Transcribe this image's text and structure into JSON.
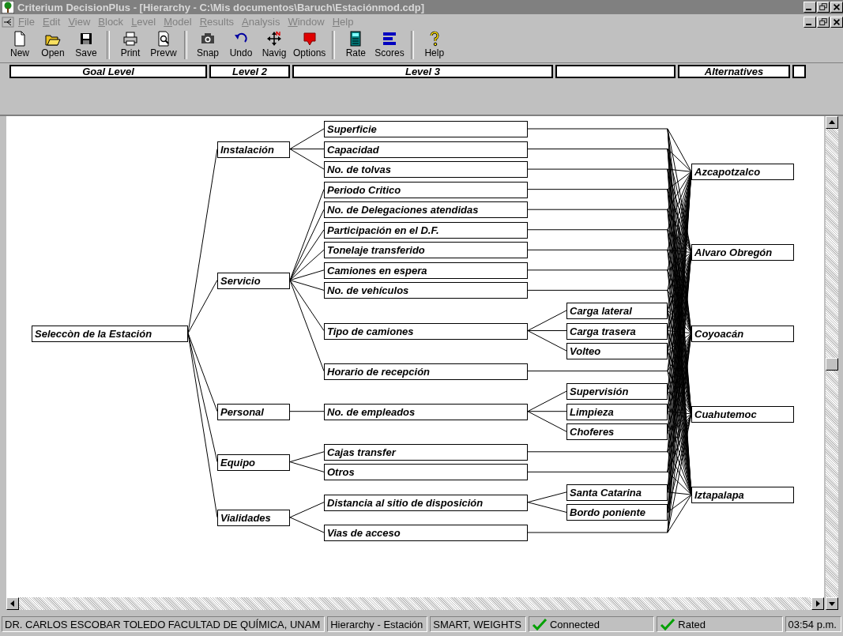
{
  "window": {
    "title": "Criterium DecisionPlus - [Hierarchy - C:\\Mis documentos\\Baruch\\Estaciónmod.cdp]"
  },
  "menu": [
    {
      "label": "File",
      "disabled": true
    },
    {
      "label": "Edit",
      "disabled": true
    },
    {
      "label": "View",
      "disabled": true
    },
    {
      "label": "Block",
      "disabled": true
    },
    {
      "label": "Level",
      "disabled": true
    },
    {
      "label": "Model",
      "disabled": true
    },
    {
      "label": "Results",
      "disabled": true
    },
    {
      "label": "Analysis",
      "disabled": true
    },
    {
      "label": "Window",
      "disabled": true
    },
    {
      "label": "Help",
      "disabled": true
    }
  ],
  "toolbar": {
    "groups": [
      [
        "New",
        "Open",
        "Save"
      ],
      [
        "Print",
        "Prevw"
      ],
      [
        "Snap",
        "Undo",
        "Navig",
        "Options"
      ],
      [
        "Rate",
        "Scores"
      ],
      [
        "Help"
      ]
    ]
  },
  "levels": [
    "Goal Level",
    "Level 2",
    "Level 3",
    "Alternatives"
  ],
  "hierarchy": {
    "label": "Seleccòn de la Estación",
    "children": [
      {
        "label": "Instalación",
        "children": [
          {
            "label": "Superficie"
          },
          {
            "label": "Capacidad"
          },
          {
            "label": "No. de tolvas"
          }
        ]
      },
      {
        "label": "Servicio",
        "children": [
          {
            "label": "Periodo Critico"
          },
          {
            "label": "No. de Delegaciones atendidas"
          },
          {
            "label": "Participación en el D.F."
          },
          {
            "label": "Tonelaje transferido"
          },
          {
            "label": "Camiones en espera"
          },
          {
            "label": "No. de vehículos"
          },
          {
            "label": "Tipo de camiones",
            "children": [
              {
                "label": "Carga lateral"
              },
              {
                "label": "Carga trasera"
              },
              {
                "label": "Volteo"
              }
            ]
          },
          {
            "label": "Horario de recepción"
          }
        ]
      },
      {
        "label": "Personal",
        "children": [
          {
            "label": "No. de empleados",
            "children": [
              {
                "label": "Supervisión"
              },
              {
                "label": "Limpieza"
              },
              {
                "label": "Choferes"
              }
            ]
          }
        ]
      },
      {
        "label": "Equipo",
        "children": [
          {
            "label": "Cajas transfer"
          },
          {
            "label": "Otros"
          }
        ]
      },
      {
        "label": "Vialidades",
        "children": [
          {
            "label": "Distancia al sitio de disposición",
            "children": [
              {
                "label": "Santa Catarina"
              },
              {
                "label": "Bordo poniente"
              }
            ]
          },
          {
            "label": "Vias de acceso"
          }
        ]
      }
    ]
  },
  "alternatives": [
    "Azcapotzalco",
    "Alvaro Obregón",
    "Coyoacán",
    "Cuahutemoc",
    "Iztapalapa"
  ],
  "status_bar": [
    {
      "text": "DR. CARLOS ESCOBAR TOLEDO FACULTAD DE QUÍMICA, UNAM",
      "checked": false
    },
    {
      "text": "Hierarchy - Estación",
      "checked": false
    },
    {
      "text": "SMART, WEIGHTS",
      "checked": false
    },
    {
      "text": "Connected",
      "checked": true
    },
    {
      "text": "Rated",
      "checked": true
    },
    {
      "text": "03:54 p.m.",
      "checked": false
    }
  ]
}
